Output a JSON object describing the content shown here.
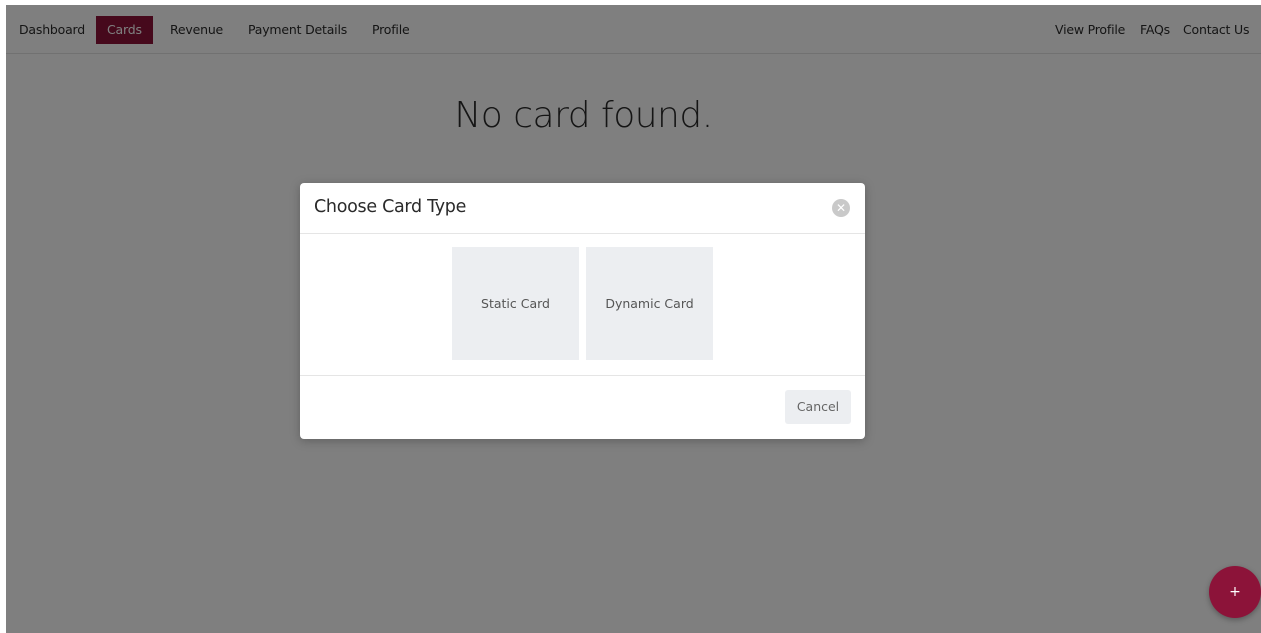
{
  "navbar": {
    "left": [
      "Dashboard",
      "Cards",
      "Revenue",
      "Payment Details",
      "Profile"
    ],
    "active": "Cards",
    "right": [
      "View Profile",
      "FAQs",
      "Contact Us"
    ]
  },
  "main": {
    "empty_message": "No card found."
  },
  "modal": {
    "title": "Choose Card Type",
    "close_icon": "close-circle-icon",
    "options": [
      "Static Card",
      "Dynamic Card"
    ],
    "cancel_label": "Cancel"
  },
  "fab": {
    "label": "+",
    "icon": "plus-icon"
  },
  "colors": {
    "accent": "#8c1339",
    "overlay": "rgba(0,0,0,0.5)",
    "option_bg": "#eceef1"
  }
}
